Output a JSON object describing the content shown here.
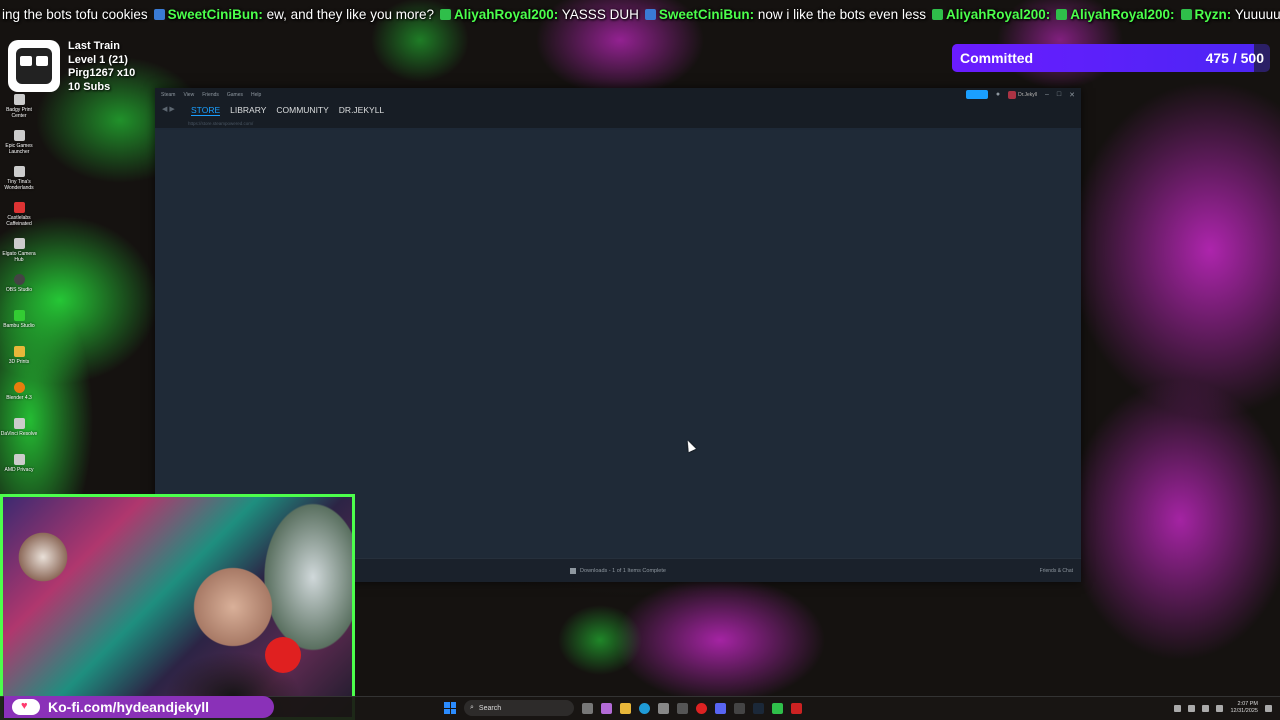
{
  "ticker": [
    {
      "user": "",
      "message": "ing the bots tofu cookies",
      "icon": "bolt"
    },
    {
      "user": "SweetCiniBun:",
      "message": "ew, and they like you more?",
      "icon": "chat"
    },
    {
      "user": "AliyahRoyal200:",
      "message": "YASSS DUH",
      "icon": "chat"
    },
    {
      "user": "SweetCiniBun:",
      "message": "now i like the bots even less",
      "icon": "bolt"
    },
    {
      "user": "AliyahRoyal200:",
      "message": "",
      "icon": "chat"
    },
    {
      "user": "AliyahRoyal200:",
      "message": "",
      "icon": "chat"
    },
    {
      "user": "Ryzn:",
      "message": "Yuuuuur",
      "icon": "chat"
    }
  ],
  "train": {
    "title": "Last Train",
    "level": "Level 1  (21)",
    "user": "Pirg1267 x10",
    "subs": "10 Subs"
  },
  "goal": {
    "label": "Committed",
    "count": "475 / 500",
    "progress": 0.95
  },
  "desktop_icons": [
    {
      "label": "Badgy Print Center",
      "icon": "printer-icon"
    },
    {
      "label": "Epic Games Launcher",
      "icon": "epic-games-icon"
    },
    {
      "label": "Tiny Tina's Wonderlands",
      "icon": "game-icon"
    },
    {
      "label": "Castlelabs Caffeinated",
      "icon": "caffeinated-icon"
    },
    {
      "label": "Elgato Camera Hub",
      "icon": "camera-icon"
    },
    {
      "label": "OBS Studio",
      "icon": "obs-icon"
    },
    {
      "label": "Bambu Studio",
      "icon": "bambu-icon"
    },
    {
      "label": "3D Prints",
      "icon": "folder-icon"
    },
    {
      "label": "Blender 4.3",
      "icon": "blender-icon"
    },
    {
      "label": "DaVinci Resolve",
      "icon": "davinci-icon"
    },
    {
      "label": "AMD Privacy",
      "icon": "amd-icon"
    }
  ],
  "steam": {
    "menu": [
      "Steam",
      "View",
      "Friends",
      "Games",
      "Help"
    ],
    "nav": [
      "STORE",
      "LIBRARY",
      "COMMUNITY",
      "DR.JEKYLL"
    ],
    "active_tab": "STORE",
    "url": "https://store.steampowered.com/",
    "username": "Dr.Jekyll",
    "status": "Downloads - 1 of 1 Items Complete",
    "friends": "Friends & Chat"
  },
  "kofi": {
    "text": "Ko-fi.com/hydeandjekyll"
  },
  "taskbar": {
    "search_placeholder": "Search",
    "time": "2:07 PM",
    "date": "12/31/2025"
  },
  "colors": {
    "accent_green": "#4cff4c",
    "goal_purple": "#6a1cff",
    "steam_blue": "#1a9fff",
    "kofi_purple": "#8a31b8"
  }
}
